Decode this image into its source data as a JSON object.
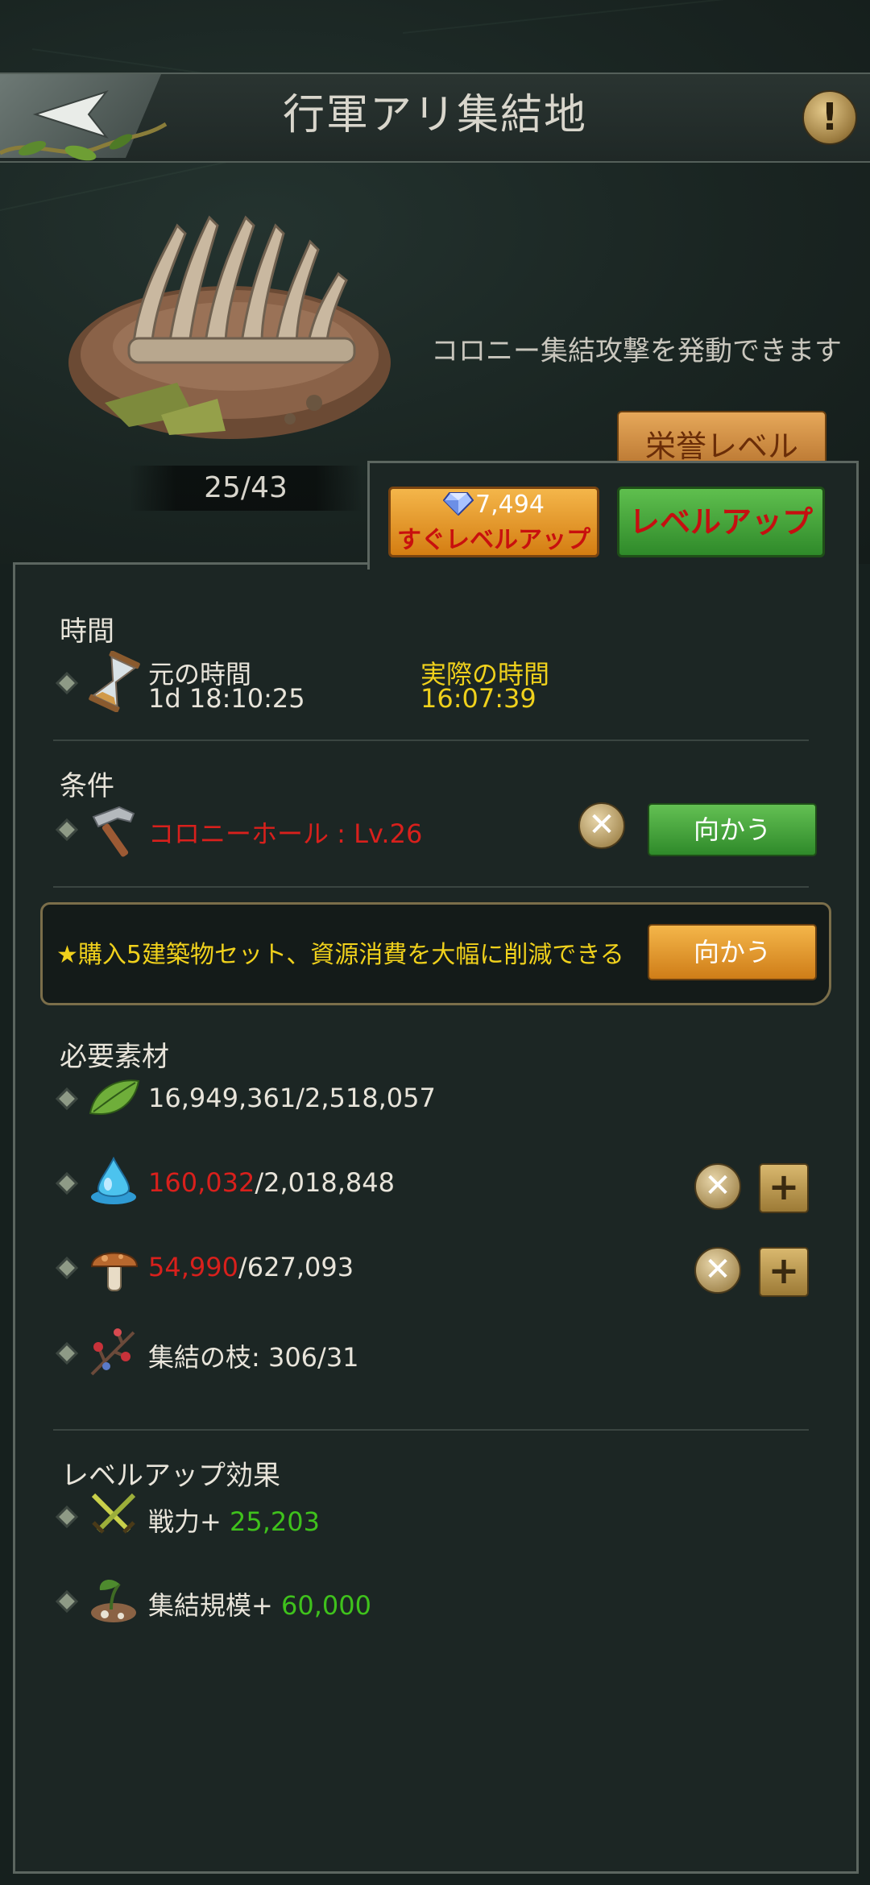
{
  "header": {
    "title": "行軍アリ集結地"
  },
  "building": {
    "level": "25/43",
    "description": "コロニー集結攻撃を発動できます",
    "honor_label": "栄誉レベル"
  },
  "actions": {
    "instant_cost": "7,494",
    "instant_label": "すぐレベルアップ",
    "levelup_label": "レベルアップ"
  },
  "time": {
    "title": "時間",
    "original_label": "元の時間",
    "original_value": "1d 18:10:25",
    "actual_label": "実際の時間",
    "actual_value": "16:07:39"
  },
  "conditions": {
    "title": "条件",
    "requirement": "コロニーホール : Lv.26",
    "go_label": "向かう"
  },
  "promo": {
    "text": "★購入5建築物セット、資源消費を大幅に削減できる",
    "go_label": "向かう"
  },
  "materials": {
    "title": "必要素材",
    "items": [
      {
        "have": "16,949,361",
        "need": "/2,518,057",
        "icon": "leaf-icon"
      },
      {
        "have": "160,032",
        "need": "/2,018,848",
        "icon": "water-drop-icon"
      },
      {
        "have": "54,990",
        "need": "/627,093",
        "icon": "mushroom-icon"
      },
      {
        "text": "集結の枝: 306/31",
        "icon": "branch-icon"
      }
    ]
  },
  "effects": {
    "title": "レベルアップ効果",
    "items": [
      {
        "label": "戦力+ ",
        "value": "25,203",
        "icon": "crossed-swords-icon"
      },
      {
        "label": "集結規模+ ",
        "value": "60,000",
        "icon": "sprout-icon"
      }
    ]
  },
  "colors": {
    "accent_yellow": "#f0d11c",
    "deficit_red": "#d8201c",
    "bonus_green": "#3fc21c"
  }
}
